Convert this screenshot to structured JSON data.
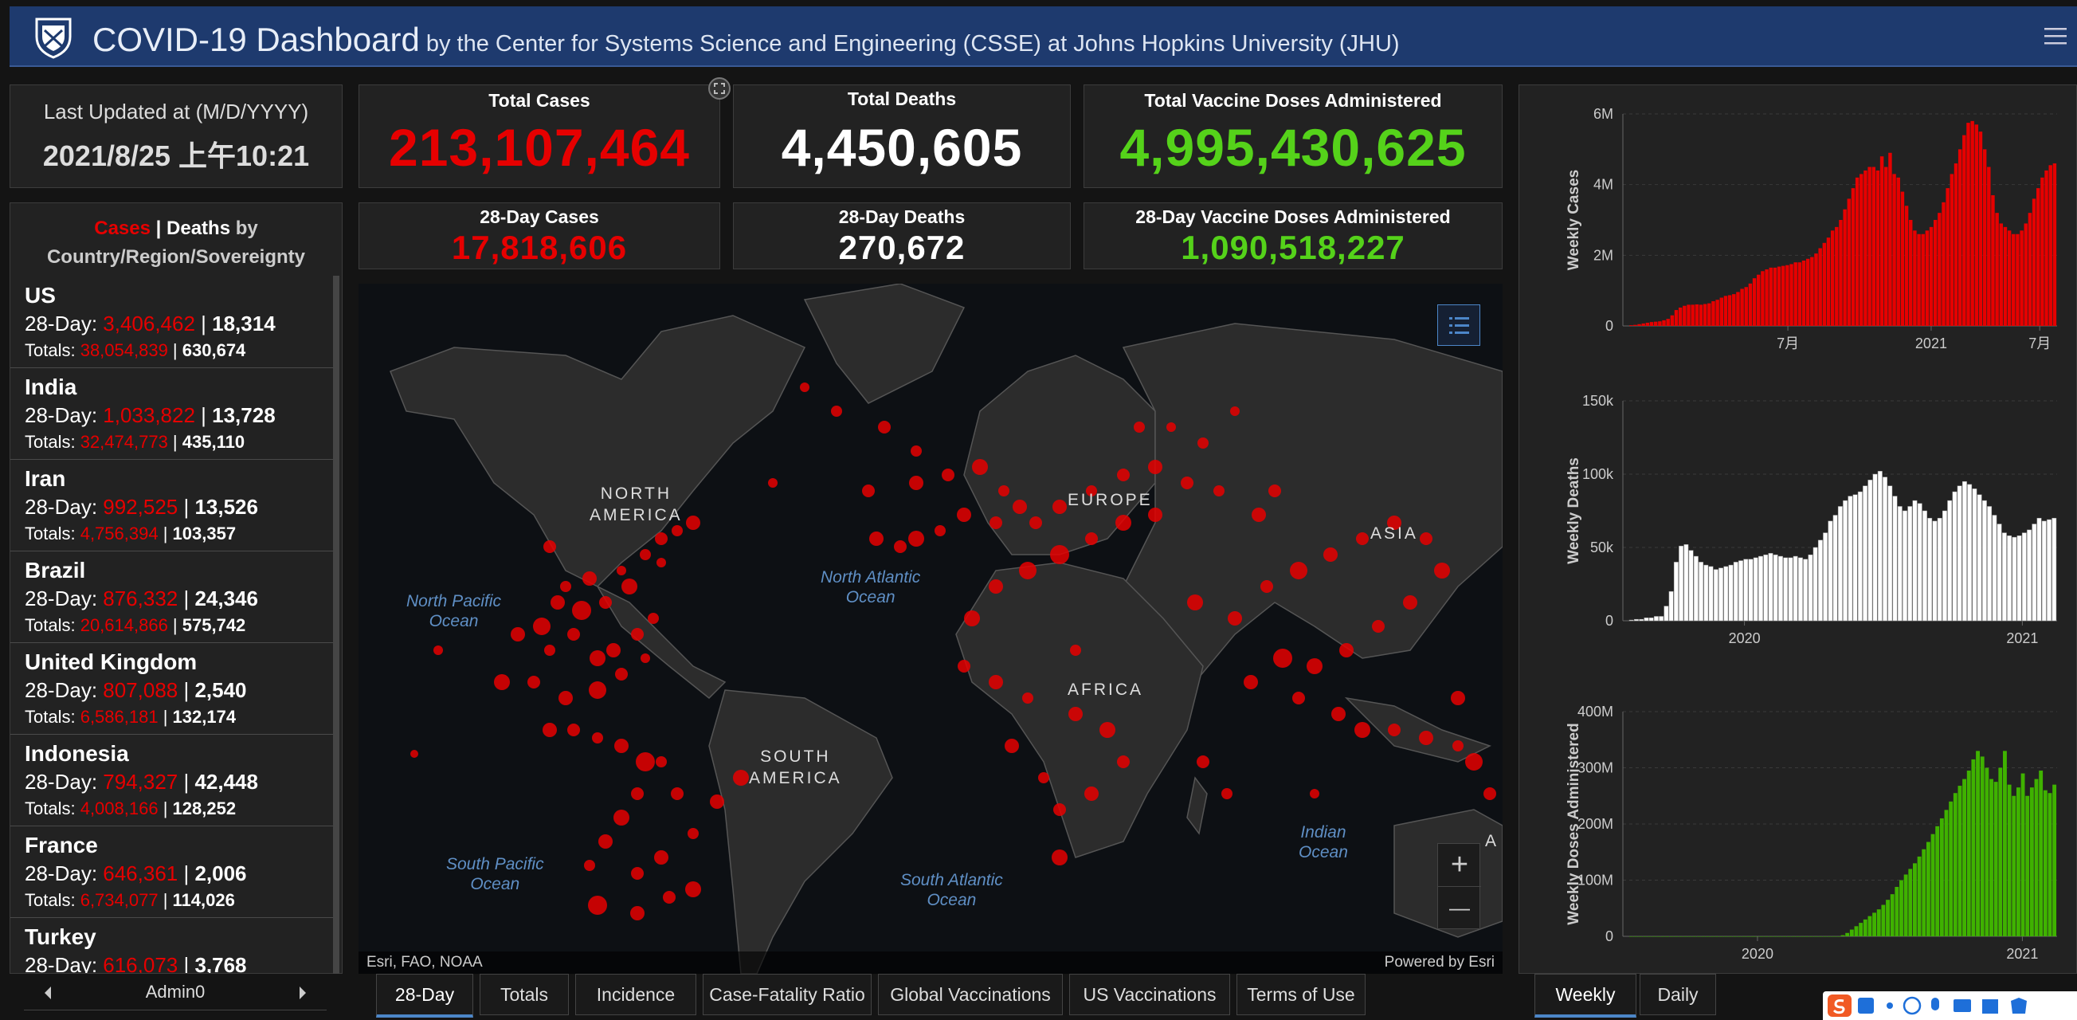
{
  "header": {
    "title": "COVID-19 Dashboard",
    "subtitle": "by the Center for Systems Science and Engineering (CSSE) at Johns Hopkins University (JHU)"
  },
  "last_updated": {
    "label": "Last Updated at (M/D/YYYY)",
    "value": "2021/8/25 上午10:21"
  },
  "totals": {
    "cases_label": "Total Cases",
    "cases": "213,107,464",
    "deaths_label": "Total Deaths",
    "deaths": "4,450,605",
    "vaccine_label": "Total Vaccine Doses Administered",
    "vaccine": "4,995,430,625",
    "cases28_label": "28-Day Cases",
    "cases28": "17,818,606",
    "deaths28_label": "28-Day Deaths",
    "deaths28": "270,672",
    "vaccine28_label": "28-Day Vaccine Doses Administered",
    "vaccine28": "1,090,518,227"
  },
  "list": {
    "header_cases": "Cases",
    "header_sep": " | ",
    "header_deaths": "Deaths",
    "header_by": " by",
    "header_line2": "Country/Region/Sovereignty",
    "prefix_28": "28-Day: ",
    "prefix_tot": "Totals: ",
    "sep": " | ",
    "items": [
      {
        "name": "US",
        "c28": "3,406,462",
        "d28": "18,314",
        "ct": "38,054,839",
        "dt": "630,674"
      },
      {
        "name": "India",
        "c28": "1,033,822",
        "d28": "13,728",
        "ct": "32,474,773",
        "dt": "435,110"
      },
      {
        "name": "Iran",
        "c28": "992,525",
        "d28": "13,526",
        "ct": "4,756,394",
        "dt": "103,357"
      },
      {
        "name": "Brazil",
        "c28": "876,332",
        "d28": "24,346",
        "ct": "20,614,866",
        "dt": "575,742"
      },
      {
        "name": "United Kingdom",
        "c28": "807,088",
        "d28": "2,540",
        "ct": "6,586,181",
        "dt": "132,174"
      },
      {
        "name": "Indonesia",
        "c28": "794,327",
        "d28": "42,448",
        "ct": "4,008,166",
        "dt": "128,252"
      },
      {
        "name": "France",
        "c28": "646,361",
        "d28": "2,006",
        "ct": "6,734,077",
        "dt": "114,026"
      },
      {
        "name": "Turkey",
        "c28": "616,073",
        "d28": "3,768",
        "ct": "",
        "dt": ""
      }
    ],
    "pager_label": "Admin0"
  },
  "map": {
    "labels": {
      "north_america": "NORTH\nAMERICA",
      "south_america": "SOUTH\nAMERICA",
      "europe": "EUROPE",
      "africa": "AFRICA",
      "asia": "ASIA",
      "edge_a": "A"
    },
    "oceans": {
      "north_pacific": "North Pacific\nOcean",
      "north_atlantic": "North Atlantic\nOcean",
      "south_pacific": "South Pacific\nOcean",
      "south_atlantic": "South Atlantic\nOcean",
      "indian": "Indian\nOcean"
    },
    "attribution": "Esri, FAO, NOAA",
    "powered": "Powered by Esri",
    "zoom_in": "+",
    "zoom_out": "—"
  },
  "tabs": [
    "28-Day",
    "Totals",
    "Incidence",
    "Case-Fatality Ratio",
    "Global Vaccinations",
    "US Vaccinations",
    "Terms of Use"
  ],
  "right_tabs": [
    "Weekly",
    "Daily"
  ],
  "colors": {
    "cases": "#e60000",
    "deaths": "#ffffff",
    "vaccine": "#3fb200",
    "header": "#1e3a6e",
    "accent": "#4c86c8"
  },
  "chart_data": [
    {
      "type": "bar",
      "ylabel": "Weekly Cases",
      "ylim": [
        0,
        6000000
      ],
      "yticks": [
        "0",
        "2M",
        "4M",
        "6M"
      ],
      "xticks": [
        "7月",
        "2021",
        "7月"
      ],
      "color": "#e60000",
      "values": [
        0.02,
        0.03,
        0.05,
        0.07,
        0.09,
        0.11,
        0.12,
        0.13,
        0.16,
        0.2,
        0.3,
        0.45,
        0.52,
        0.57,
        0.6,
        0.6,
        0.61,
        0.6,
        0.62,
        0.64,
        0.7,
        0.74,
        0.8,
        0.85,
        0.87,
        0.9,
        0.96,
        1.05,
        1.1,
        1.2,
        1.35,
        1.45,
        1.55,
        1.6,
        1.65,
        1.65,
        1.68,
        1.7,
        1.72,
        1.75,
        1.8,
        1.8,
        1.85,
        1.9,
        1.95,
        2.05,
        2.2,
        2.35,
        2.5,
        2.7,
        2.8,
        3.0,
        3.3,
        3.6,
        3.9,
        4.2,
        4.3,
        4.4,
        4.5,
        4.5,
        4.4,
        4.8,
        4.5,
        4.9,
        4.3,
        4.2,
        3.8,
        3.4,
        3.0,
        2.7,
        2.6,
        2.6,
        2.7,
        2.8,
        3.0,
        3.2,
        3.5,
        3.9,
        4.3,
        4.6,
        5.0,
        5.4,
        5.75,
        5.8,
        5.7,
        5.5,
        5.0,
        4.5,
        3.7,
        3.2,
        2.9,
        2.8,
        2.7,
        2.6,
        2.6,
        2.7,
        2.9,
        3.2,
        3.6,
        3.9,
        4.2,
        4.4,
        4.55,
        4.6
      ]
    },
    {
      "type": "bar",
      "ylabel": "Weekly Deaths",
      "ylim": [
        0,
        150000
      ],
      "yticks": [
        "0",
        "50k",
        "100k",
        "150k"
      ],
      "xticks": [
        "2020",
        "2021"
      ],
      "color": "#ffffff",
      "values": [
        0.5,
        1,
        1,
        2,
        2,
        3,
        3,
        10,
        20,
        40,
        51,
        52,
        48,
        44,
        40,
        38,
        37,
        35,
        36,
        37,
        38,
        40,
        41,
        42,
        42,
        43,
        44,
        45,
        46,
        45,
        44,
        43,
        43,
        44,
        43,
        42,
        45,
        50,
        55,
        60,
        68,
        72,
        78,
        82,
        85,
        86,
        88,
        92,
        96,
        100,
        102,
        98,
        92,
        85,
        78,
        75,
        78,
        82,
        80,
        75,
        70,
        68,
        70,
        75,
        82,
        88,
        92,
        95,
        93,
        90,
        86,
        82,
        78,
        72,
        66,
        60,
        58,
        57,
        58,
        60,
        62,
        66,
        70,
        68,
        69,
        70
      ]
    },
    {
      "type": "bar",
      "ylabel": "Weekly Doses Administered",
      "ylim": [
        0,
        400000000
      ],
      "yticks": [
        "0",
        "100M",
        "200M",
        "300M",
        "400M"
      ],
      "xticks": [
        "2020",
        "2021"
      ],
      "color": "#3fb200",
      "values": [
        0,
        0,
        0,
        0,
        0,
        0,
        0,
        0,
        0,
        0,
        0,
        0,
        0,
        0,
        0,
        0,
        0,
        0,
        0,
        0,
        0,
        0,
        0,
        0,
        0,
        0,
        0,
        0,
        0,
        0,
        0,
        0,
        0,
        0,
        0,
        0,
        0,
        0,
        0,
        0,
        0,
        0,
        0,
        0,
        0,
        0,
        0,
        2,
        6,
        12,
        18,
        24,
        30,
        36,
        42,
        48,
        56,
        65,
        75,
        88,
        100,
        110,
        120,
        130,
        142,
        155,
        168,
        182,
        196,
        210,
        225,
        240,
        255,
        268,
        280,
        295,
        315,
        330,
        320,
        300,
        280,
        275,
        300,
        330,
        270,
        250,
        265,
        290,
        250,
        265,
        280,
        295,
        260,
        255,
        270
      ]
    }
  ]
}
